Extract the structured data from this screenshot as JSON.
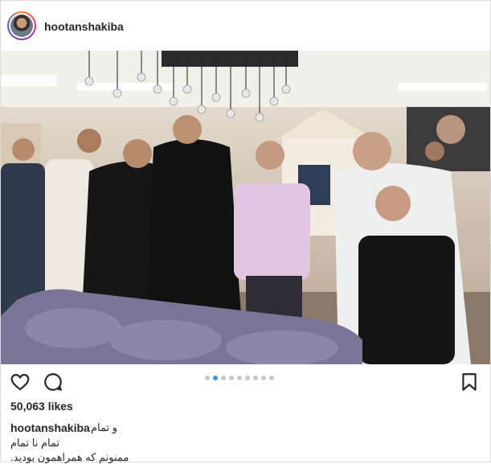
{
  "post": {
    "username": "hootanshakiba",
    "likes": "50,063 likes",
    "caption_user": "hootanshakiba",
    "caption_lines": [
      "و تمام",
      "تمام نا تمام",
      ".ممنونم که همراهمون بودید"
    ],
    "carousel": {
      "count": 9,
      "active_index": 1
    }
  },
  "icons": {
    "like": "heart-icon",
    "comment": "comment-bubble-icon",
    "save": "bookmark-icon"
  },
  "colors": {
    "active_dot": "#3897f0",
    "border": "#dbdbdb"
  }
}
